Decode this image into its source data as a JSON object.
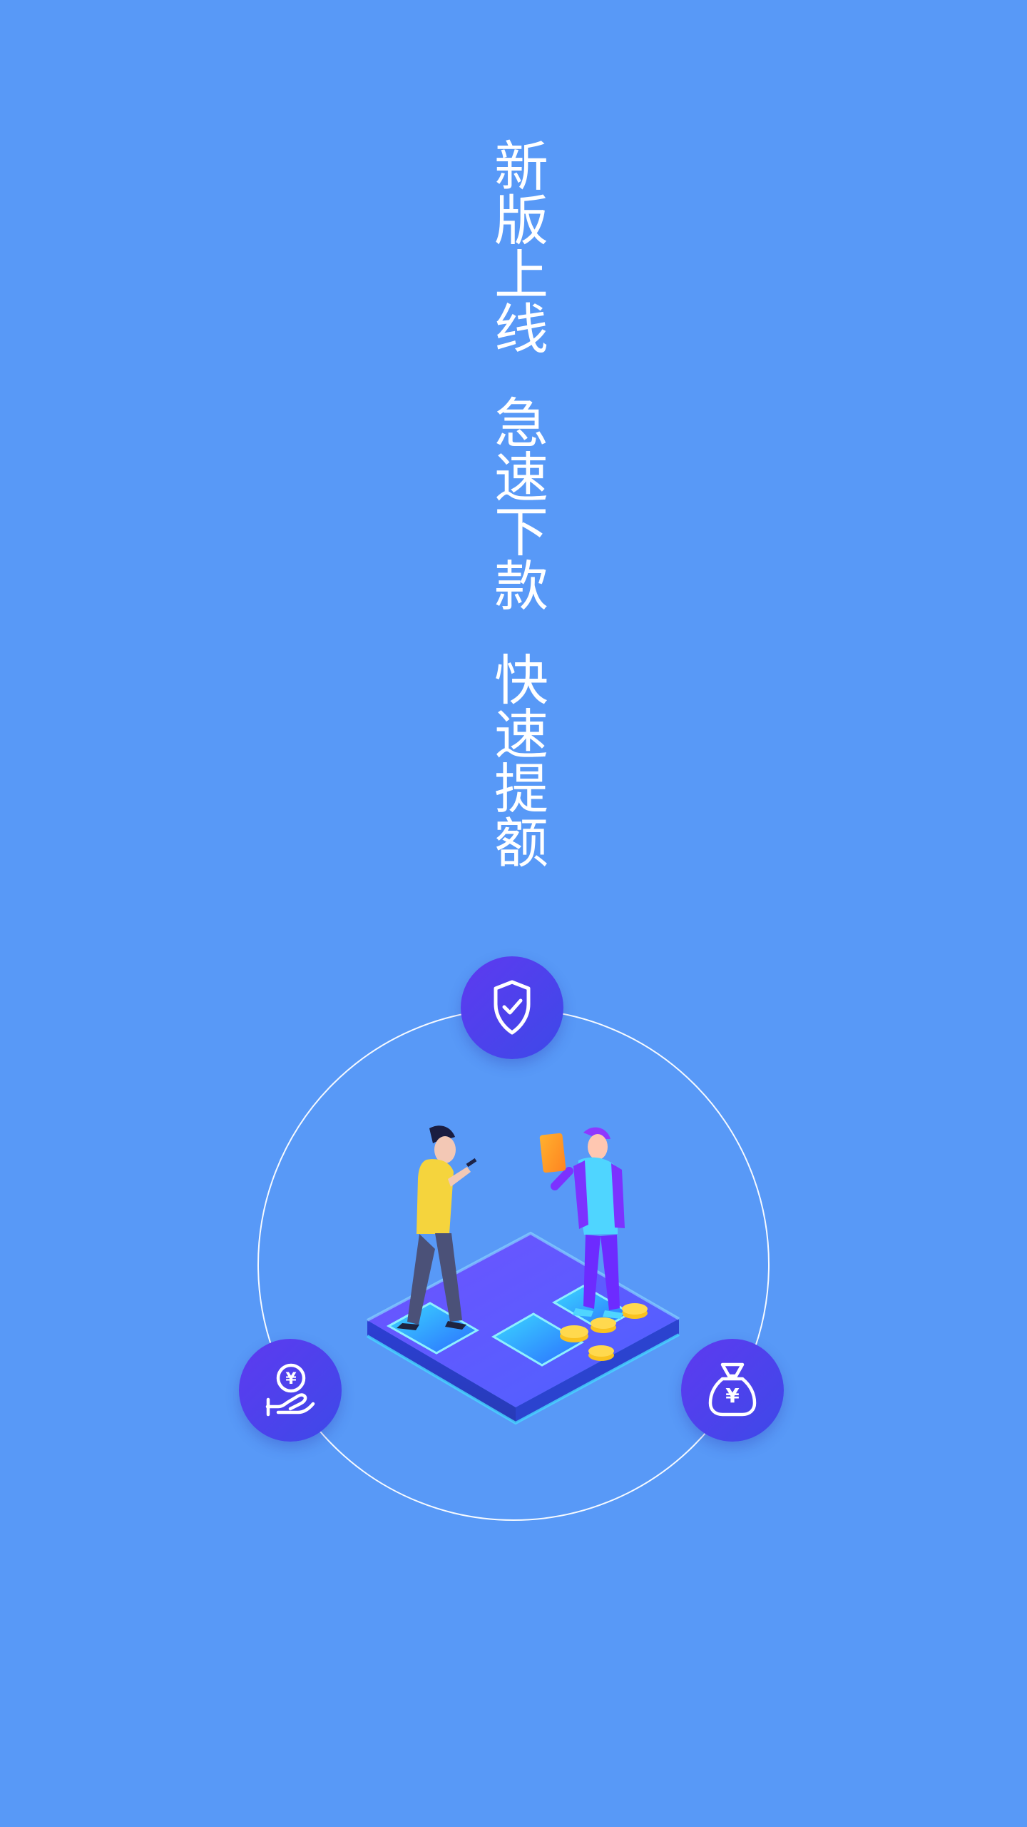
{
  "headline": {
    "line1": "新版上线",
    "line2": "急速下款",
    "line3": "快速提额"
  },
  "colors": {
    "background": "#5899f7",
    "badge_gradient_start": "#5e3af0",
    "badge_gradient_end": "#3d49e8",
    "orbit_ring": "#ffffff"
  },
  "features": [
    {
      "icon": "shield-check-icon"
    },
    {
      "icon": "hand-yuan-icon"
    },
    {
      "icon": "money-bag-icon"
    }
  ],
  "icons": {
    "yuan_symbol": "¥"
  }
}
